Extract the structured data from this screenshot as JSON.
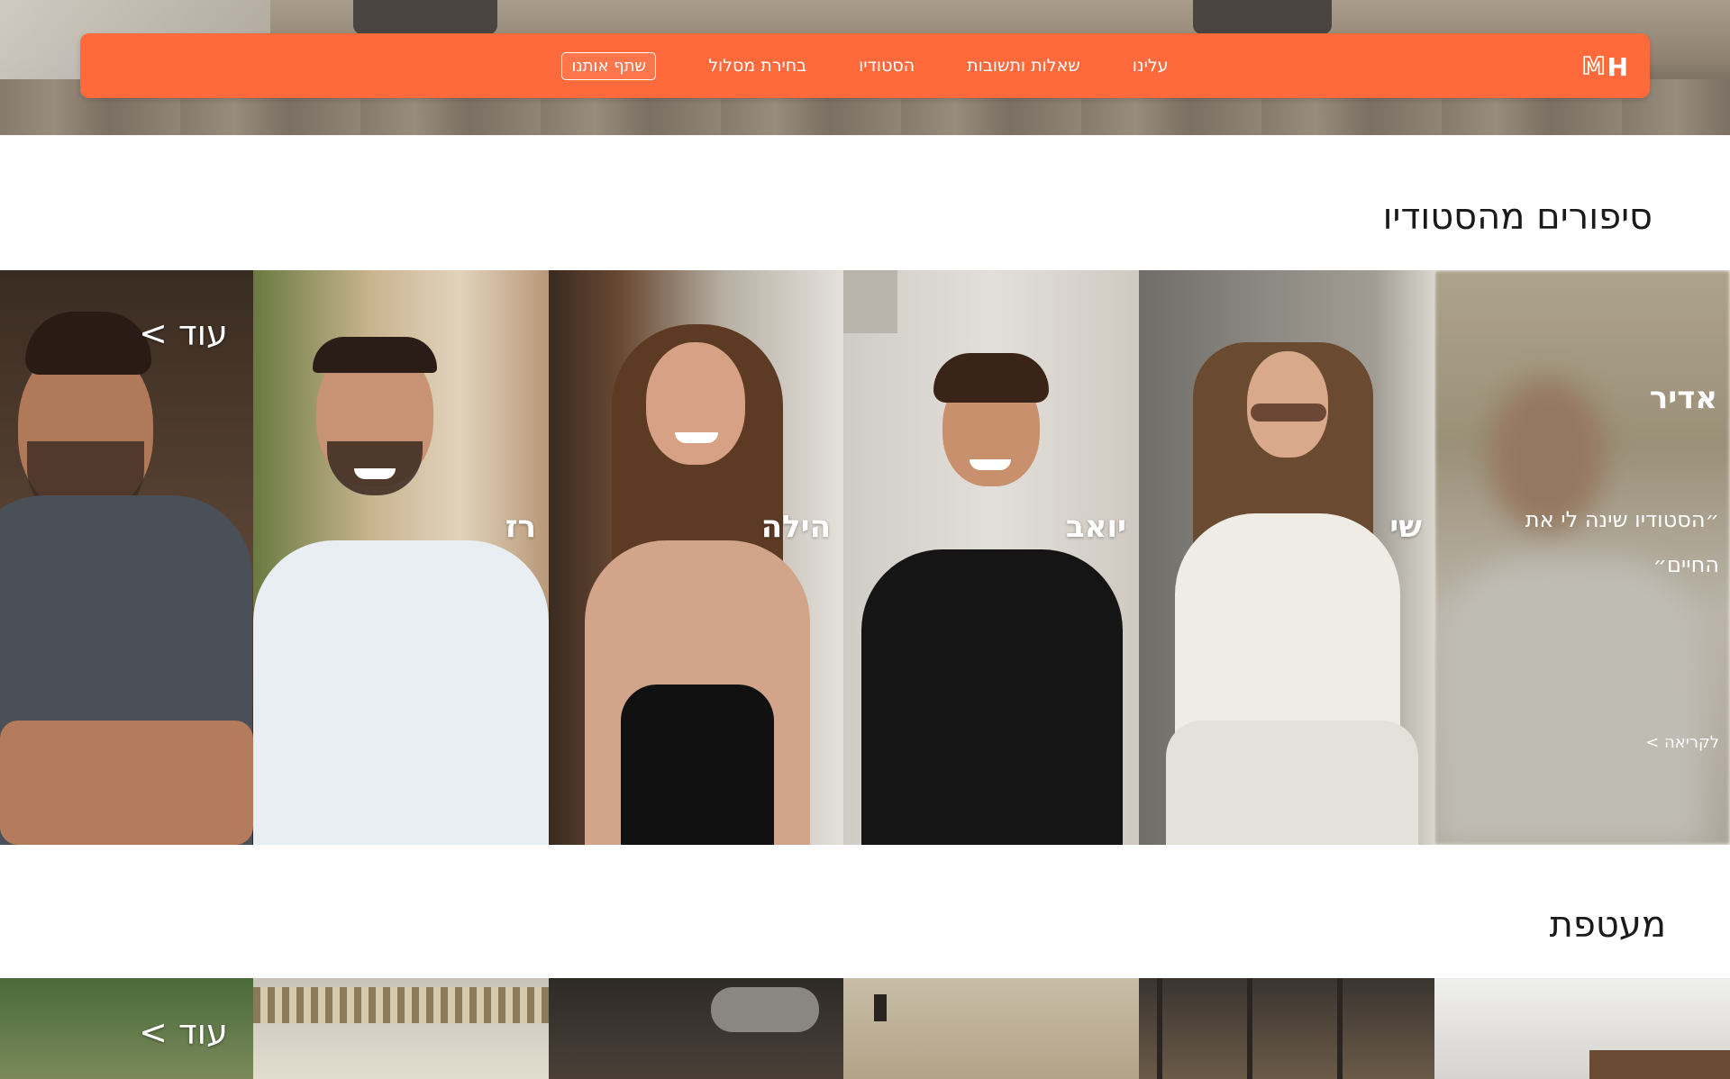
{
  "nav": {
    "logo_m": "M",
    "logo_h": "H",
    "cta_label": "שתף אותנו",
    "links": [
      "בחירת מסלול",
      "הסטודיו",
      "שאלות ותשובות",
      "עלינו"
    ]
  },
  "stories": {
    "title": "סיפורים מהסטודיו",
    "featured": {
      "name": "אדיר",
      "quote": "״הסטודיו שינה לי את החיים״",
      "read_more": "לקריאה >"
    },
    "cards": [
      {
        "name": "שי"
      },
      {
        "name": "יואב"
      },
      {
        "name": "הילה"
      },
      {
        "name": "רז"
      }
    ],
    "more_label": "עוד >"
  },
  "wrap": {
    "title": "מעטפת",
    "more_label": "עוד >"
  },
  "colors": {
    "accent": "#ff6a3d",
    "heading": "#1a1a1a"
  }
}
